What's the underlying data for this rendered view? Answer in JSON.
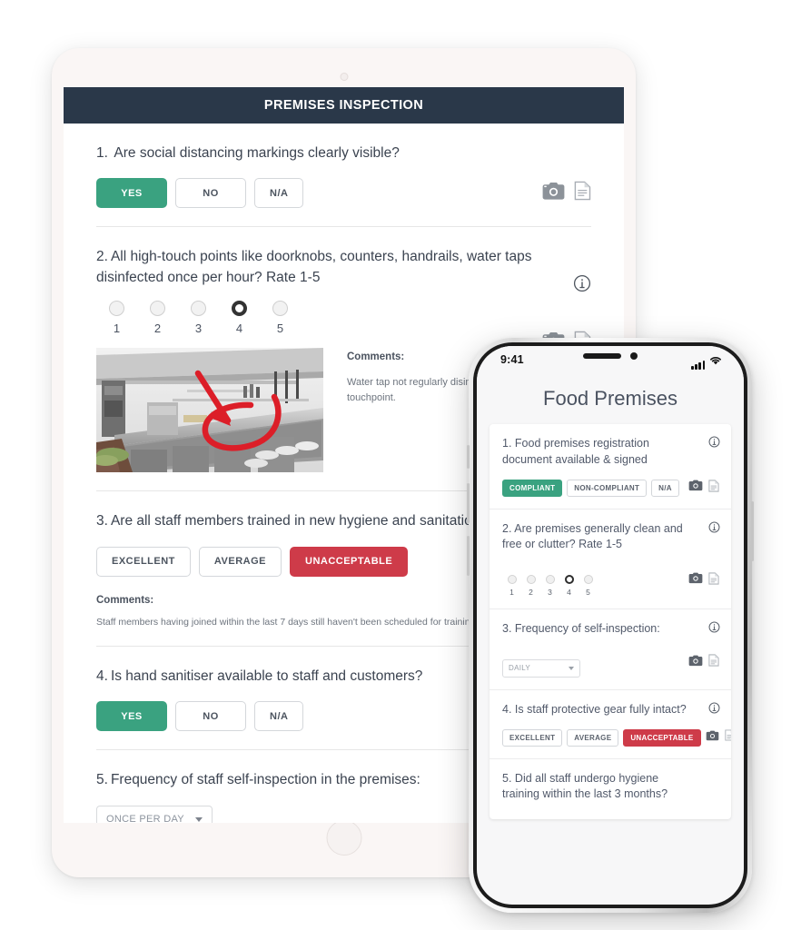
{
  "tablet": {
    "header": {
      "title": "PREMISES INSPECTION"
    },
    "questions": [
      {
        "num": "1.",
        "text": "Are social distancing markings clearly visible?",
        "type": "choice",
        "options": [
          {
            "label": "YES",
            "state": "selected-green"
          },
          {
            "label": "NO",
            "state": "default"
          },
          {
            "label": "N/A",
            "state": "default"
          }
        ],
        "icons": [
          "camera-icon",
          "document-icon"
        ]
      },
      {
        "num": "2.",
        "text": "All high-touch points like doorknobs, counters, handrails, water taps disinfected once per hour? Rate 1-5",
        "type": "rating",
        "scale": [
          "1",
          "2",
          "3",
          "4",
          "5"
        ],
        "selected": "4",
        "info": "info-icon",
        "icons": [
          "camera-icon",
          "document-icon"
        ],
        "photo": {
          "alt": "commercial-kitchen-photo",
          "annotation": "red-arrow-and-circle"
        },
        "comments_label": "Comments:",
        "comments_value": "Water tap not regularly disinfected touchpoint."
      },
      {
        "num": "3.",
        "text": "Are all staff members trained in new hygiene and sanitation",
        "type": "choice",
        "options": [
          {
            "label": "EXCELLENT",
            "state": "default"
          },
          {
            "label": "AVERAGE",
            "state": "default"
          },
          {
            "label": "UNACCEPTABLE",
            "state": "selected-red"
          }
        ],
        "comments_label": "Comments:",
        "comments_value": "Staff members having joined within the last 7 days still haven't been scheduled for training"
      },
      {
        "num": "4.",
        "text": "Is hand sanitiser available to staff and customers?",
        "type": "choice",
        "options": [
          {
            "label": "YES",
            "state": "selected-green"
          },
          {
            "label": "NO",
            "state": "default"
          },
          {
            "label": "N/A",
            "state": "default"
          }
        ]
      },
      {
        "num": "5.",
        "text": "Frequency of staff self-inspection in the premises:",
        "type": "select",
        "select_value": "ONCE PER DAY"
      }
    ]
  },
  "phone": {
    "status": {
      "time": "9:41",
      "signal": "cellular-signal-icon",
      "wifi": "wifi-icon"
    },
    "title": "Food Premises",
    "questions": [
      {
        "num": "1.",
        "text": "Food premises registration document available & signed",
        "type": "choice",
        "info": "info-icon",
        "options": [
          {
            "label": "COMPLIANT",
            "state": "selected-green"
          },
          {
            "label": "NON-COMPLIANT",
            "state": "default"
          },
          {
            "label": "N/A",
            "state": "default"
          }
        ],
        "icons": [
          "camera-icon",
          "document-icon"
        ]
      },
      {
        "num": "2.",
        "text": "Are premises generally clean and free or clutter? Rate 1-5",
        "type": "rating",
        "info": "info-icon",
        "scale": [
          "1",
          "2",
          "3",
          "4",
          "5"
        ],
        "selected": "4",
        "icons": [
          "camera-icon",
          "document-icon"
        ]
      },
      {
        "num": "3.",
        "text": "Frequency of self-inspection:",
        "type": "select",
        "info": "info-icon",
        "select_value": "DAILY",
        "icons": [
          "camera-icon",
          "document-icon"
        ]
      },
      {
        "num": "4.",
        "text": "Is staff protective gear fully intact?",
        "type": "choice",
        "info": "info-icon",
        "options": [
          {
            "label": "EXCELLENT",
            "state": "default"
          },
          {
            "label": "AVERAGE",
            "state": "default"
          },
          {
            "label": "UNACCEPTABLE",
            "state": "selected-red"
          }
        ],
        "icons": [
          "camera-icon",
          "document-icon"
        ]
      },
      {
        "num": "5.",
        "text": "Did all staff undergo hygiene training within the last 3 months?",
        "type": "text"
      }
    ]
  },
  "colors": {
    "header_navy": "#2a3849",
    "accent_green": "#3aa280",
    "accent_red": "#ce3b49",
    "text_primary": "#3b4350",
    "text_secondary": "#6d747e"
  }
}
